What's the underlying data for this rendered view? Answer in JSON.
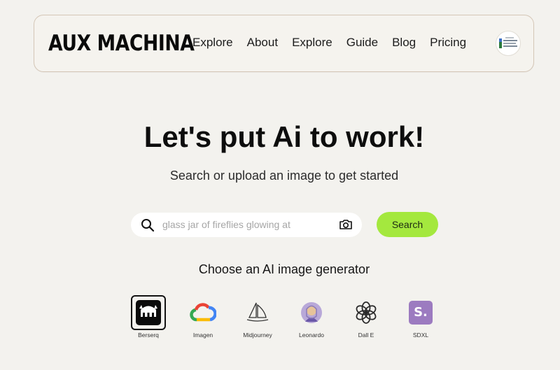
{
  "brand": {
    "logo_text": "AUX MACHINA"
  },
  "nav": {
    "items": [
      {
        "label": "Explore"
      },
      {
        "label": "About"
      },
      {
        "label": "Explore"
      },
      {
        "label": "Guide"
      },
      {
        "label": "Blog"
      },
      {
        "label": "Pricing"
      }
    ],
    "avatar_icon": "user-avatar-icon"
  },
  "hero": {
    "title": "Let's put Ai to work!",
    "subtitle": "Search or upload an image to get started"
  },
  "search": {
    "placeholder": "glass jar of fireflies glowing at",
    "value": "",
    "button_label": "Search",
    "search_icon": "magnifier-icon",
    "upload_icon": "camera-icon",
    "button_color": "#a4e83e"
  },
  "generators": {
    "heading": "Choose an AI image generator",
    "selected": "Berserq",
    "items": [
      {
        "label": "Berserq",
        "icon": "berserq-logo-icon"
      },
      {
        "label": "Imagen",
        "icon": "google-cloud-icon"
      },
      {
        "label": "Midjourney",
        "icon": "sailboat-icon"
      },
      {
        "label": "Leonardo",
        "icon": "leonardo-portrait-icon"
      },
      {
        "label": "Dall E",
        "icon": "openai-icon"
      },
      {
        "label": "SDXL",
        "icon": "sdxl-s-icon",
        "icon_text": "S."
      }
    ]
  }
}
